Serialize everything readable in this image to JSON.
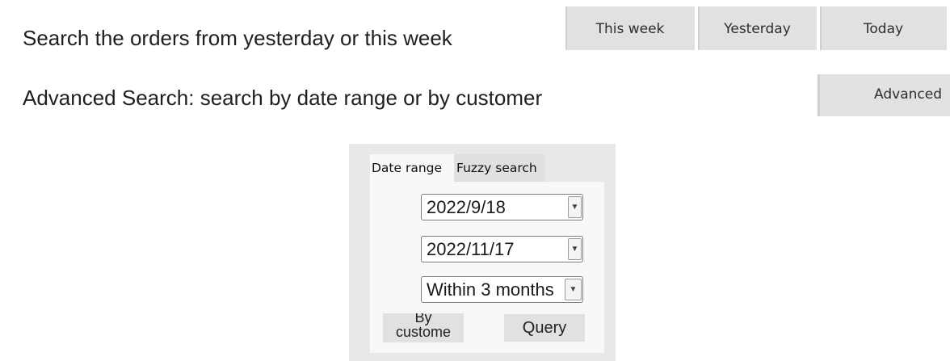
{
  "quick_search": {
    "description": "Search the orders from yesterday or this week",
    "buttons": {
      "this_week": "This week",
      "yesterday": "Yesterday",
      "today": "Today"
    }
  },
  "advanced_search": {
    "description": "Advanced Search: search by date range or by customer",
    "button_label": "Advanced"
  },
  "panel": {
    "tabs": {
      "date_range": "Date range",
      "fuzzy_search": "Fuzzy search"
    },
    "date_start": "2022/9/18",
    "date_end": "2022/11/17",
    "period": "Within 3 months",
    "dropdown_arrow": "▼",
    "by_customer_label": "By customer",
    "query_label": "Query"
  }
}
